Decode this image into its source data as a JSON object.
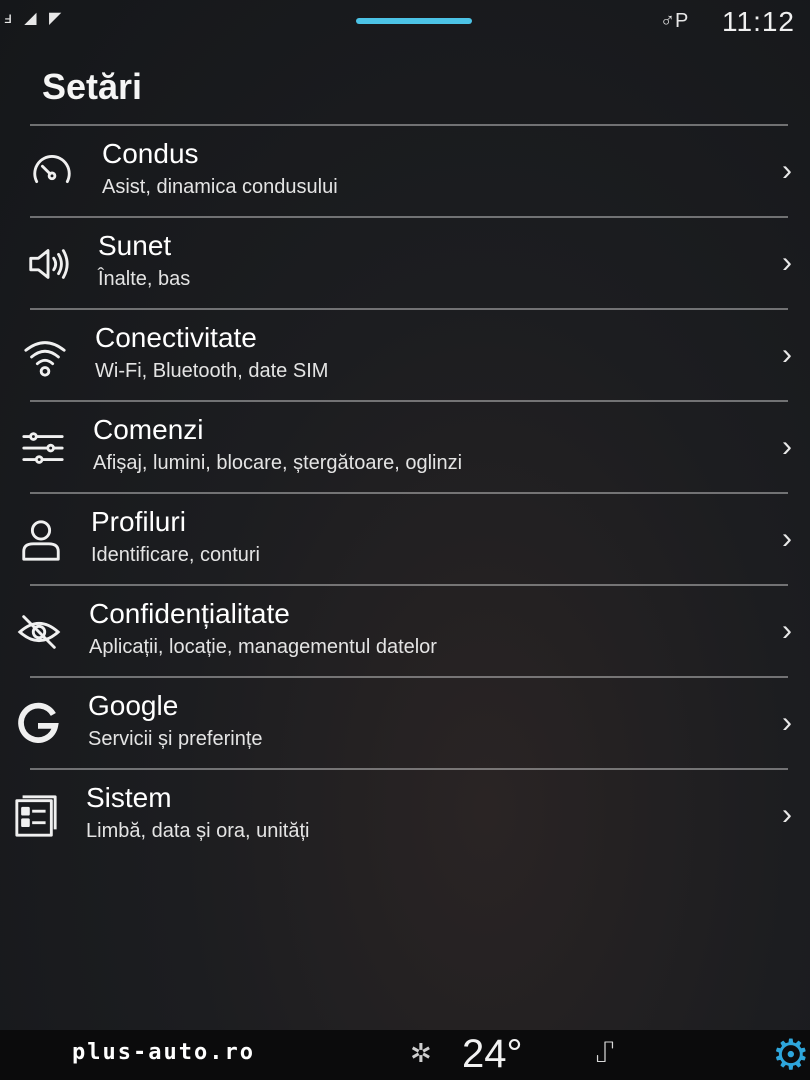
{
  "status_bar": {
    "left_icons": "ⅎ ◢ ◤",
    "user_indicator": "♂P",
    "time": "11:12"
  },
  "page": {
    "title": "Setări"
  },
  "settings_items": [
    {
      "icon": "speedometer-icon",
      "label": "Condus",
      "subtitle": "Asist, dinamica condusului"
    },
    {
      "icon": "speaker-icon",
      "label": "Sunet",
      "subtitle": "Înalte, bas"
    },
    {
      "icon": "wifi-icon",
      "label": "Conectivitate",
      "subtitle": "Wi-Fi, Bluetooth, date SIM"
    },
    {
      "icon": "sliders-icon",
      "label": "Comenzi",
      "subtitle": "Afișaj, lumini, blocare, ștergătoare, oglinzi"
    },
    {
      "icon": "person-icon",
      "label": "Profiluri",
      "subtitle": "Identificare, conturi"
    },
    {
      "icon": "eye-slash-icon",
      "label": "Confidențialitate",
      "subtitle": "Aplicații, locație, managementul datelor"
    },
    {
      "icon": "google-icon",
      "label": "Google",
      "subtitle": "Servicii și preferințe"
    },
    {
      "icon": "system-icon",
      "label": "Sistem",
      "subtitle": "Limbă, data și ora, unități"
    }
  ],
  "bottom_bar": {
    "watermark": "plus-auto.ro",
    "fan_icon": "fan-icon",
    "temperature": "24°",
    "seat_icon": "seat-icon",
    "settings_icon": "gear-icon"
  },
  "colors": {
    "accent": "#4cc3e6",
    "settings_gear": "#2ea6dc"
  }
}
